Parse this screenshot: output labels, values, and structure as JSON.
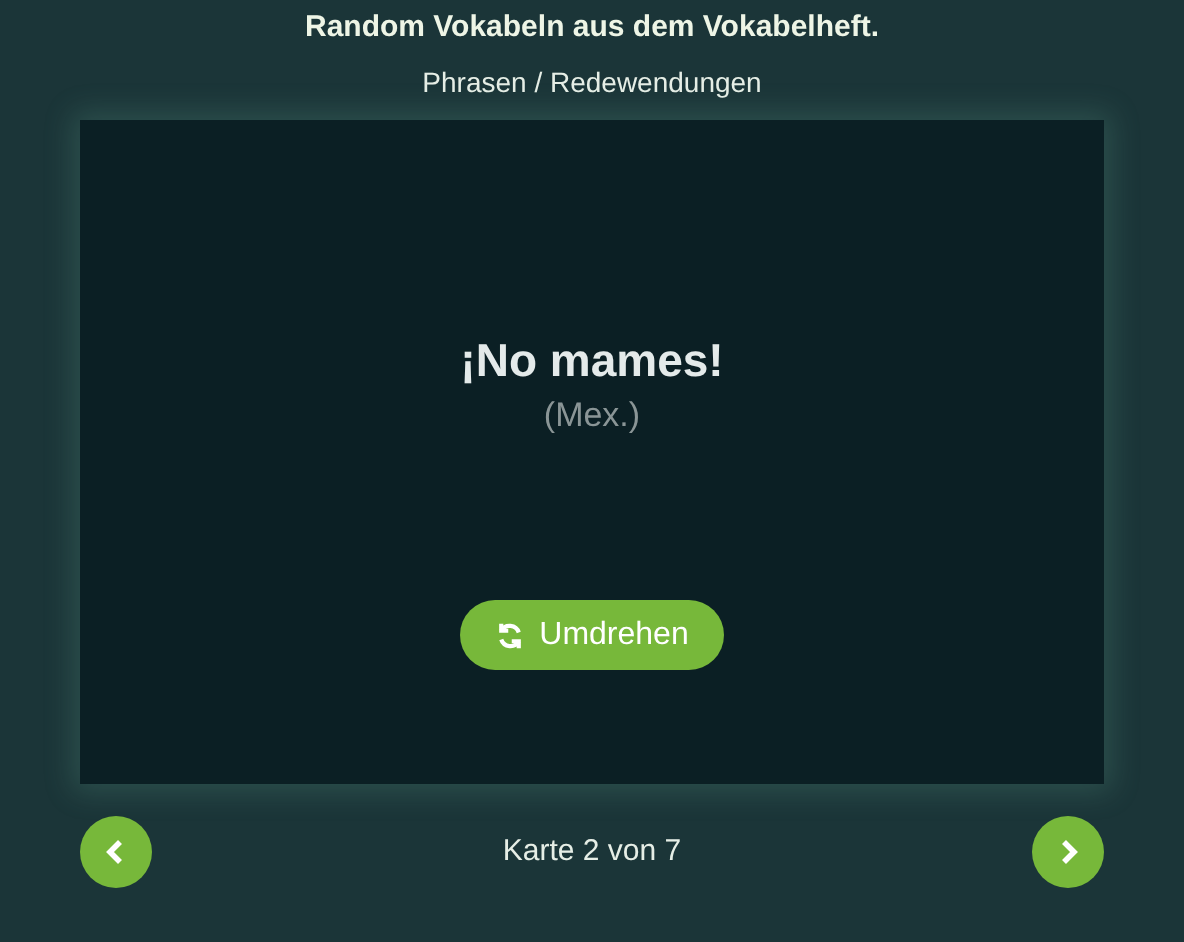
{
  "header": {
    "title": "Random Vokabeln aus dem Vokabelheft.",
    "subtitle": "Phrasen / Redewendungen"
  },
  "card": {
    "term": "¡No mames!",
    "note": "(Mex.)",
    "flip_button": "Umdrehen"
  },
  "footer": {
    "counter": "Karte 2 von 7"
  }
}
